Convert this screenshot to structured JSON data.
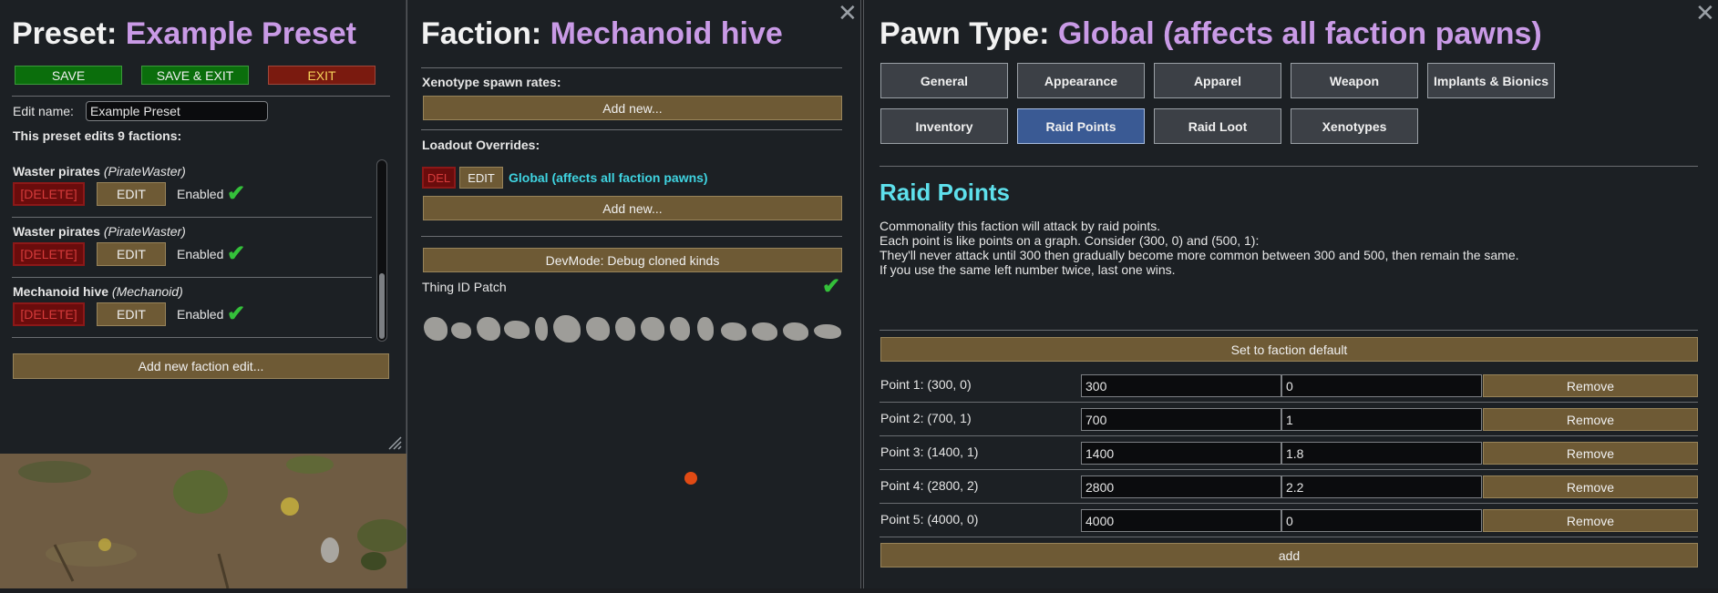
{
  "left": {
    "title_prefix": "Preset: ",
    "title_name": "Example Preset",
    "save": "SAVE",
    "save_exit": "SAVE & EXIT",
    "exit": "EXIT",
    "edit_name_label": "Edit name:",
    "edit_name_value": "Example Preset",
    "summary": "This preset edits 9 factions:",
    "factions": [
      {
        "name": "Waster pirates",
        "def": "(PirateWaster)",
        "delete": "[DELETE]",
        "edit": "EDIT",
        "status": "Enabled"
      },
      {
        "name": "Waster pirates",
        "def": "(PirateWaster)",
        "delete": "[DELETE]",
        "edit": "EDIT",
        "status": "Enabled"
      },
      {
        "name": "Mechanoid hive",
        "def": "(Mechanoid)",
        "delete": "[DELETE]",
        "edit": "EDIT",
        "status": "Enabled"
      }
    ],
    "add_faction": "Add new faction edit..."
  },
  "middle": {
    "title_prefix": "Faction: ",
    "title_name": "Mechanoid hive",
    "xeno_label": "Xenotype spawn rates:",
    "add_new_1": "Add new...",
    "loadout_label": "Loadout Overrides:",
    "del": "DEL",
    "edit": "EDIT",
    "override_name": "Global (affects all faction pawns)",
    "add_new_2": "Add new...",
    "devmode": "DevMode: Debug cloned kinds",
    "thing_id": "Thing ID Patch"
  },
  "right": {
    "title_prefix": "Pawn Type: ",
    "title_name": "Global (affects all faction pawns)",
    "tabs_row1": [
      "General",
      "Appearance",
      "Apparel",
      "Weapon",
      "Implants & Bionics"
    ],
    "tabs_row2": [
      "Inventory",
      "Raid Points",
      "Raid Loot",
      "Xenotypes"
    ],
    "active_tab": "Raid Points",
    "section_title": "Raid Points",
    "desc": [
      "Commonality this faction will attack by raid points.",
      "Each point is like points on a graph. Consider (300, 0) and (500, 1):",
      "They'll never attack until 300 then gradually become more common between 300 and 500, then remain the same.",
      "If you use the same left number twice, last one wins."
    ],
    "set_default": "Set to faction default",
    "points": [
      {
        "label": "Point 1: (300, 0)",
        "x": "300",
        "y": "0",
        "remove": "Remove"
      },
      {
        "label": "Point 2: (700, 1)",
        "x": "700",
        "y": "1",
        "remove": "Remove"
      },
      {
        "label": "Point 3: (1400, 1)",
        "x": "1400",
        "y": "1.8",
        "remove": "Remove"
      },
      {
        "label": "Point 4: (2800, 2)",
        "x": "2800",
        "y": "2.2",
        "remove": "Remove"
      },
      {
        "label": "Point 5: (4000, 0)",
        "x": "4000",
        "y": "0",
        "remove": "Remove"
      }
    ],
    "add": "add"
  },
  "colors": {
    "accent_title": "#c99ae6",
    "override_link": "#3fd3e0",
    "section_title": "#5ee0ec",
    "button_brown": "#6e5a35",
    "active_tab": "#3a5a94"
  }
}
